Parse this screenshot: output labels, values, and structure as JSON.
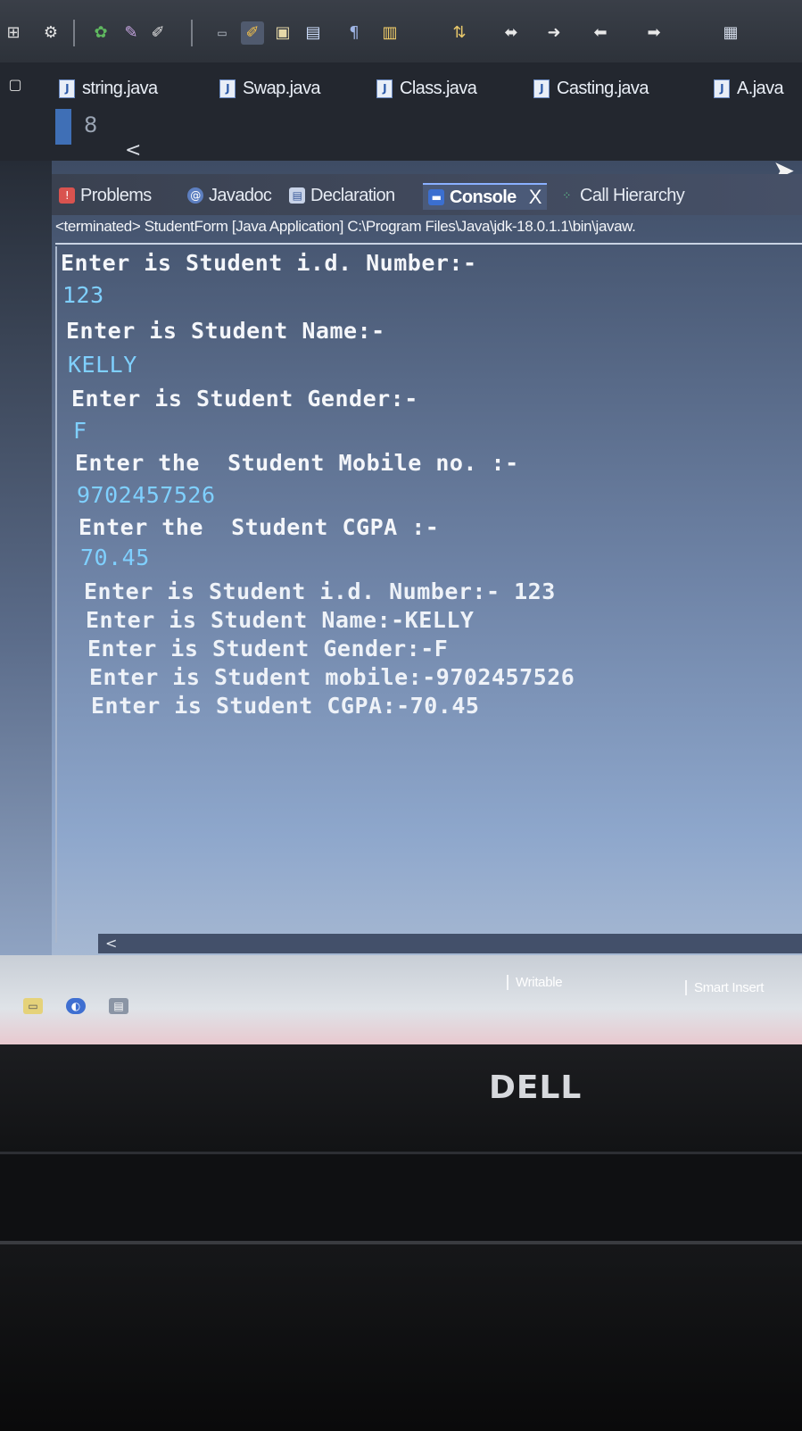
{
  "toolbar": {
    "icons": [
      "new-wizard-icon",
      "debug-icon",
      "run-icon",
      "brush-icon",
      "open-type-icon",
      "save-icon",
      "paragraph-icon",
      "pin-icon",
      "next-annotation-icon",
      "back-icon",
      "forward-icon",
      "previous-edit-icon",
      "next-edit-icon",
      "perspective-icon"
    ]
  },
  "editor": {
    "tabs": [
      {
        "label": "string.java"
      },
      {
        "label": "Swap.java"
      },
      {
        "label": "Class.java"
      },
      {
        "label": "Casting.java"
      },
      {
        "label": "A.java"
      }
    ],
    "line_number": "8",
    "left_char": "<"
  },
  "views": {
    "tabs": [
      {
        "label": "Problems"
      },
      {
        "label": "Javadoc"
      },
      {
        "label": "Declaration"
      },
      {
        "label": "Console"
      },
      {
        "label": "Call Hierarchy"
      }
    ],
    "close_glyph": "X"
  },
  "console": {
    "status": "<terminated> StudentForm [Java Application] C:\\Program Files\\Java\\jdk-18.0.1.1\\bin\\javaw.",
    "lines": [
      "Enter is Student i.d. Number:-",
      "123",
      "Enter is Student Name:-",
      "KELLY",
      "Enter is Student Gender:-",
      "F",
      "Enter the  Student Mobile no. :-",
      "9702457526",
      "Enter the  Student CGPA :-",
      "70.45",
      "Enter is Student i.d. Number:- 123",
      "Enter is Student Name:-KELLY",
      "Enter is Student Gender:-F",
      "Enter is Student mobile:-9702457526",
      "Enter is Student CGPA:-70.45"
    ],
    "scroll_left": "<"
  },
  "statusbar": {
    "writable": "Writable",
    "insert_mode": "Smart Insert"
  },
  "bezel": {
    "brand": "DELL"
  }
}
